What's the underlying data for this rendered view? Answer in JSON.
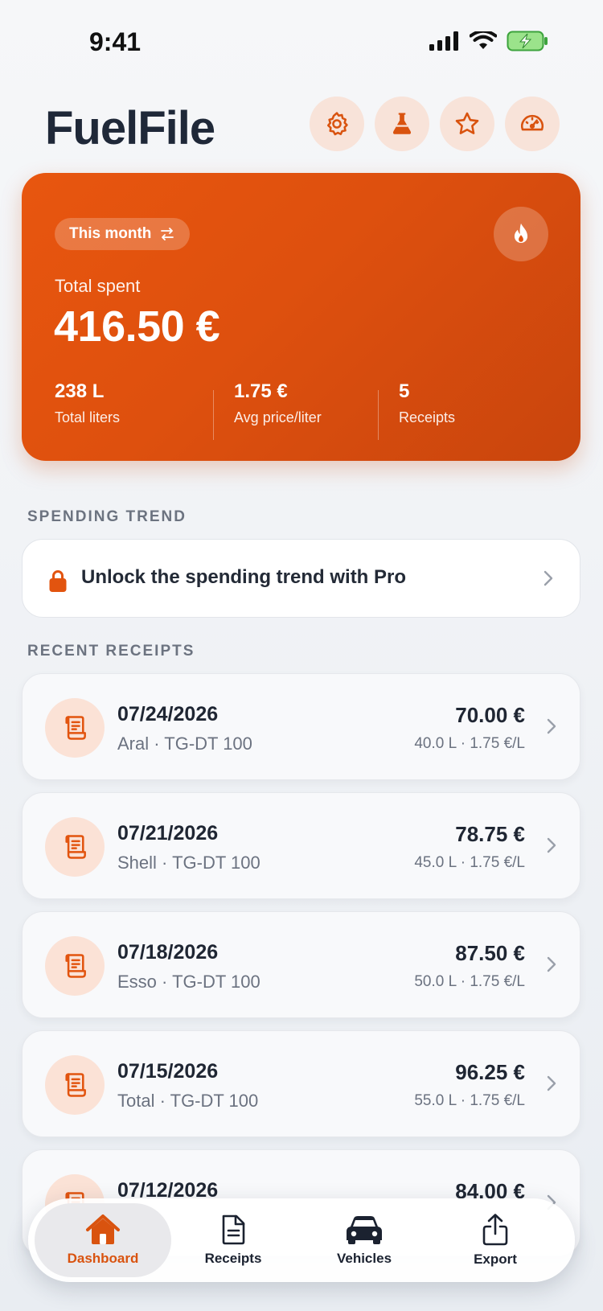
{
  "status_bar": {
    "time": "9:41"
  },
  "header": {
    "title": "FuelFile",
    "buttons": [
      "gear-icon",
      "flask-icon",
      "star-icon",
      "gauge-icon"
    ]
  },
  "summary": {
    "period": "This month",
    "total_label": "Total spent",
    "total_value": "416.50 €",
    "stats": [
      {
        "value": "238 L",
        "label": "Total liters"
      },
      {
        "value": "1.75 €",
        "label": "Avg price/liter"
      },
      {
        "value": "5",
        "label": "Receipts"
      }
    ]
  },
  "sections": {
    "trend_title": "SPENDING TREND",
    "recent_title": "RECENT RECEIPTS"
  },
  "pro_banner": {
    "text": "Unlock the spending trend with Pro"
  },
  "receipts": [
    {
      "date": "07/24/2026",
      "sub": "Aral · TG-DT 100",
      "amount": "70.00 €",
      "detail": "40.0 L · 1.75 €/L"
    },
    {
      "date": "07/21/2026",
      "sub": "Shell · TG-DT 100",
      "amount": "78.75 €",
      "detail": "45.0 L · 1.75 €/L"
    },
    {
      "date": "07/18/2026",
      "sub": "Esso · TG-DT 100",
      "amount": "87.50 €",
      "detail": "50.0 L · 1.75 €/L"
    },
    {
      "date": "07/15/2026",
      "sub": "Total · TG-DT 100",
      "amount": "96.25 €",
      "detail": "55.0 L · 1.75 €/L"
    },
    {
      "date": "07/12/2026",
      "sub": "",
      "amount": "84.00 €",
      "detail": ""
    }
  ],
  "tab_bar": {
    "tabs": [
      {
        "label": "Dashboard",
        "active": true
      },
      {
        "label": "Receipts",
        "active": false
      },
      {
        "label": "Vehicles",
        "active": false
      },
      {
        "label": "Export",
        "active": false
      }
    ]
  },
  "colors": {
    "accent": "#e2540f",
    "accent_soft": "#f8e3d9"
  }
}
